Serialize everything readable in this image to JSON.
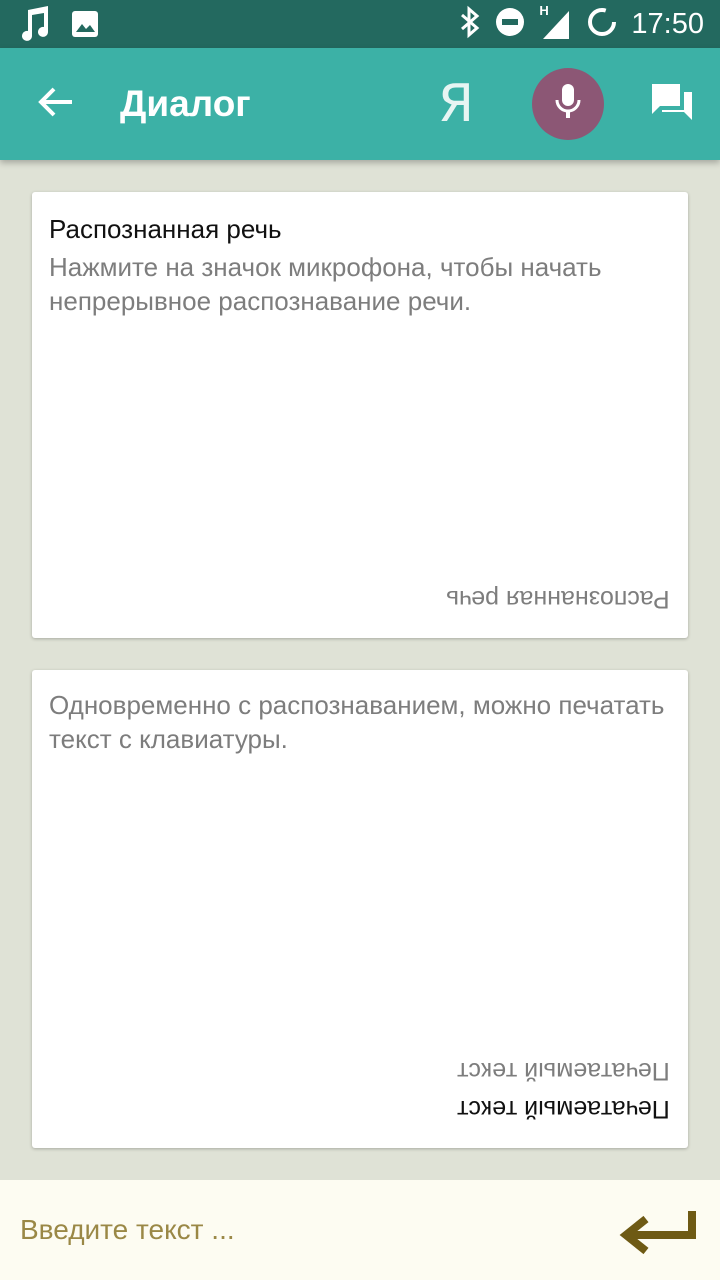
{
  "status_bar": {
    "time": "17:50",
    "network_label": "H"
  },
  "app_bar": {
    "title": "Диалог",
    "yandex_label": "Я"
  },
  "speech_card": {
    "title": "Распознанная речь",
    "hint": "Нажмите на значок микрофона, чтобы начать непрерывное распознавание речи.",
    "flipped_label": "Распознанная речь"
  },
  "typed_card": {
    "hint": "Одновременно с распознаванием, можно печатать текст с клавиатуры.",
    "flipped_hint_label": "Печатаемый текст",
    "flipped_label": "Печатаемый текст"
  },
  "input": {
    "placeholder": "Введите текст ...",
    "value": ""
  },
  "colors": {
    "status_bar": "#23695f",
    "app_bar": "#3cb1a6",
    "mic_button": "#8c5775",
    "background": "#dfe2d6",
    "input_bar": "#fdfcf2",
    "enter_arrow": "#6e5a14"
  },
  "icons": {
    "status_left": [
      "music-note-icon",
      "image-icon"
    ],
    "status_right": [
      "bluetooth-icon",
      "do-not-disturb-icon",
      "signal-icon",
      "battery-charging-icon"
    ],
    "app_bar": [
      "back-arrow-icon",
      "microphone-icon",
      "chat-icon"
    ],
    "input_bar": [
      "enter-arrow-icon"
    ]
  }
}
